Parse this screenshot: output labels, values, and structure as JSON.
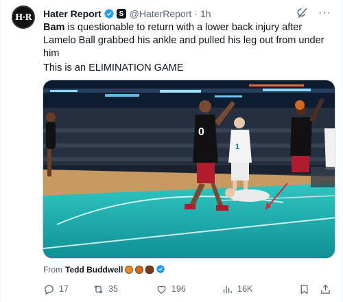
{
  "author": {
    "avatar_text": "H·R",
    "display_name": "Hater Report",
    "handle": "@HaterReport",
    "separator": "·",
    "time": "1h",
    "more": "···"
  },
  "tweet": {
    "bold_name": "Bam",
    "text_after_bold": " is questionable to return with a lower back injury after Lamelo Ball grabbed his ankle and pulled his leg out from under him",
    "line2": "This is an ELIMINATION GAME"
  },
  "attribution": {
    "prefix": "From",
    "name": "Tedd Buddwell"
  },
  "actions": {
    "replies": "17",
    "reposts": "35",
    "likes": "196",
    "views": "16K"
  },
  "media": {
    "type": "video-still",
    "icons": [
      "verified-badge-icon",
      "grok-icon",
      "reply-icon",
      "repost-icon",
      "like-icon",
      "views-icon",
      "bookmark-icon",
      "share-icon"
    ]
  },
  "colors": {
    "verified": "#1d9bf0",
    "court_teal": "#19b5b0",
    "court_wood": "#c79a62",
    "text_secondary": "#536471"
  }
}
